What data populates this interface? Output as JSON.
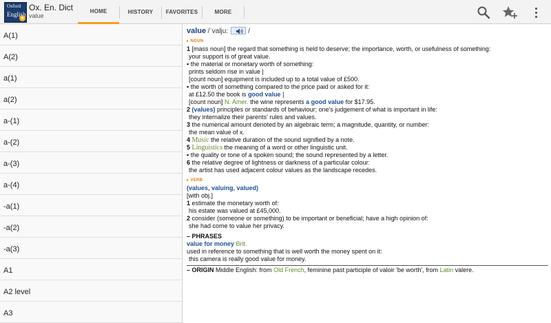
{
  "app": {
    "title": "Ox. En. Dict",
    "subtitle": "value",
    "logo_line1": "Oxford",
    "logo_line2": "English"
  },
  "tabs": [
    {
      "label": "HOME",
      "active": true
    },
    {
      "label": "HISTORY",
      "active": false
    },
    {
      "label": "FAVORITES",
      "active": false
    },
    {
      "label": "MORE",
      "active": false
    }
  ],
  "icons": {
    "search": "search-icon",
    "favorite": "star-add-icon",
    "overflow": "overflow-menu-icon",
    "audio": "speaker-icon"
  },
  "colors": {
    "accent": "#f0a020",
    "headword": "#1f3f7a",
    "phrase": "#1f4f90",
    "label_green": "#5e8a2a",
    "pos_orange": "#e07b1a"
  },
  "list_items": [
    "A(1)",
    "A(2)",
    "a(1)",
    "a(2)",
    "a-(1)",
    "a-(2)",
    "a-(3)",
    "a-(4)",
    "-a(1)",
    "-a(2)",
    "-a(3)",
    "A1",
    "A2 level",
    "A3"
  ],
  "entry": {
    "headword": "value",
    "pron_open": "/ˈvalju:",
    "pron_close": "/",
    "pos_noun": "NOUN",
    "s1_num": "1",
    "s1_text": "[mass noun] the regard that something is held to deserve; the importance, worth, or usefulness of something:",
    "s1_ex": "your support is of great value.",
    "s1_sub1": "▪ the material or monetary worth of something:",
    "s1_sub1_ex": "prints seldom rise in value |",
    "s1_sub1_ex2": "[count noun] equipment is included up to a total value of £500.",
    "s1_sub2": "▪ the worth of something compared to the price paid or asked for it:",
    "s1_sub2_ex_pre": "at £12.50 the book is ",
    "s1_sub2_ex_phrase": "good value",
    "s1_sub2_ex_post": " |",
    "s1_sub2_ex2_pre": "[count noun] ",
    "s1_sub2_ex2_label": "N. Amer.",
    "s1_sub2_ex2_mid": " the wine represents ",
    "s1_sub2_ex2_phrase": "a good value",
    "s1_sub2_ex2_post": " for $17.95.",
    "s2_num": "2",
    "s2_phrase": "(values)",
    "s2_text": " principles or standards of behaviour; one's judgement of what is important in life:",
    "s2_ex": "they internalize their parents' rules and values.",
    "s3_num": "3",
    "s3_text": " the numerical amount denoted by an algebraic term; a magnitude, quantity, or number:",
    "s3_ex": "the mean value of x.",
    "s4_num": "4",
    "s4_label": "Music",
    "s4_text": " the relative duration of the sound signified by a note.",
    "s5_num": "5",
    "s5_label": "Linguistics",
    "s5_text": " the meaning of a word or other linguistic unit.",
    "s5_sub": "▪ the quality or tone of a spoken sound; the sound represented by a letter.",
    "s6_num": "6",
    "s6_text": " the relative degree of lightness or darkness of a particular colour:",
    "s6_ex": "the artist has used adjacent colour values as the landscape recedes.",
    "pos_verb": "VERB",
    "verb_forms": "(values, valuing, valued)",
    "verb_gram": "[with obj.]",
    "v1_num": "1",
    "v1_text": " estimate the monetary worth of:",
    "v1_ex": "his estate was valued at £45,000.",
    "v2_num": "2",
    "v2_text": " consider (someone or something) to be important or beneficial; have a high opinion of:",
    "v2_ex": "she had come to value her privacy.",
    "phrases_head": "– PHRASES",
    "phrase1": "value for money",
    "phrase1_label": " Brit.",
    "phrase1_def": "used in reference to something that is well worth the money spent on it:",
    "phrase1_ex": "this camera is really good value for money.",
    "origin_head": "– ORIGIN",
    "origin_pre": " Middle English: from ",
    "origin_src1": "Old French",
    "origin_mid": ", feminine past participle of valoir 'be worth', from ",
    "origin_src2": "Latin",
    "origin_post": " valere."
  }
}
